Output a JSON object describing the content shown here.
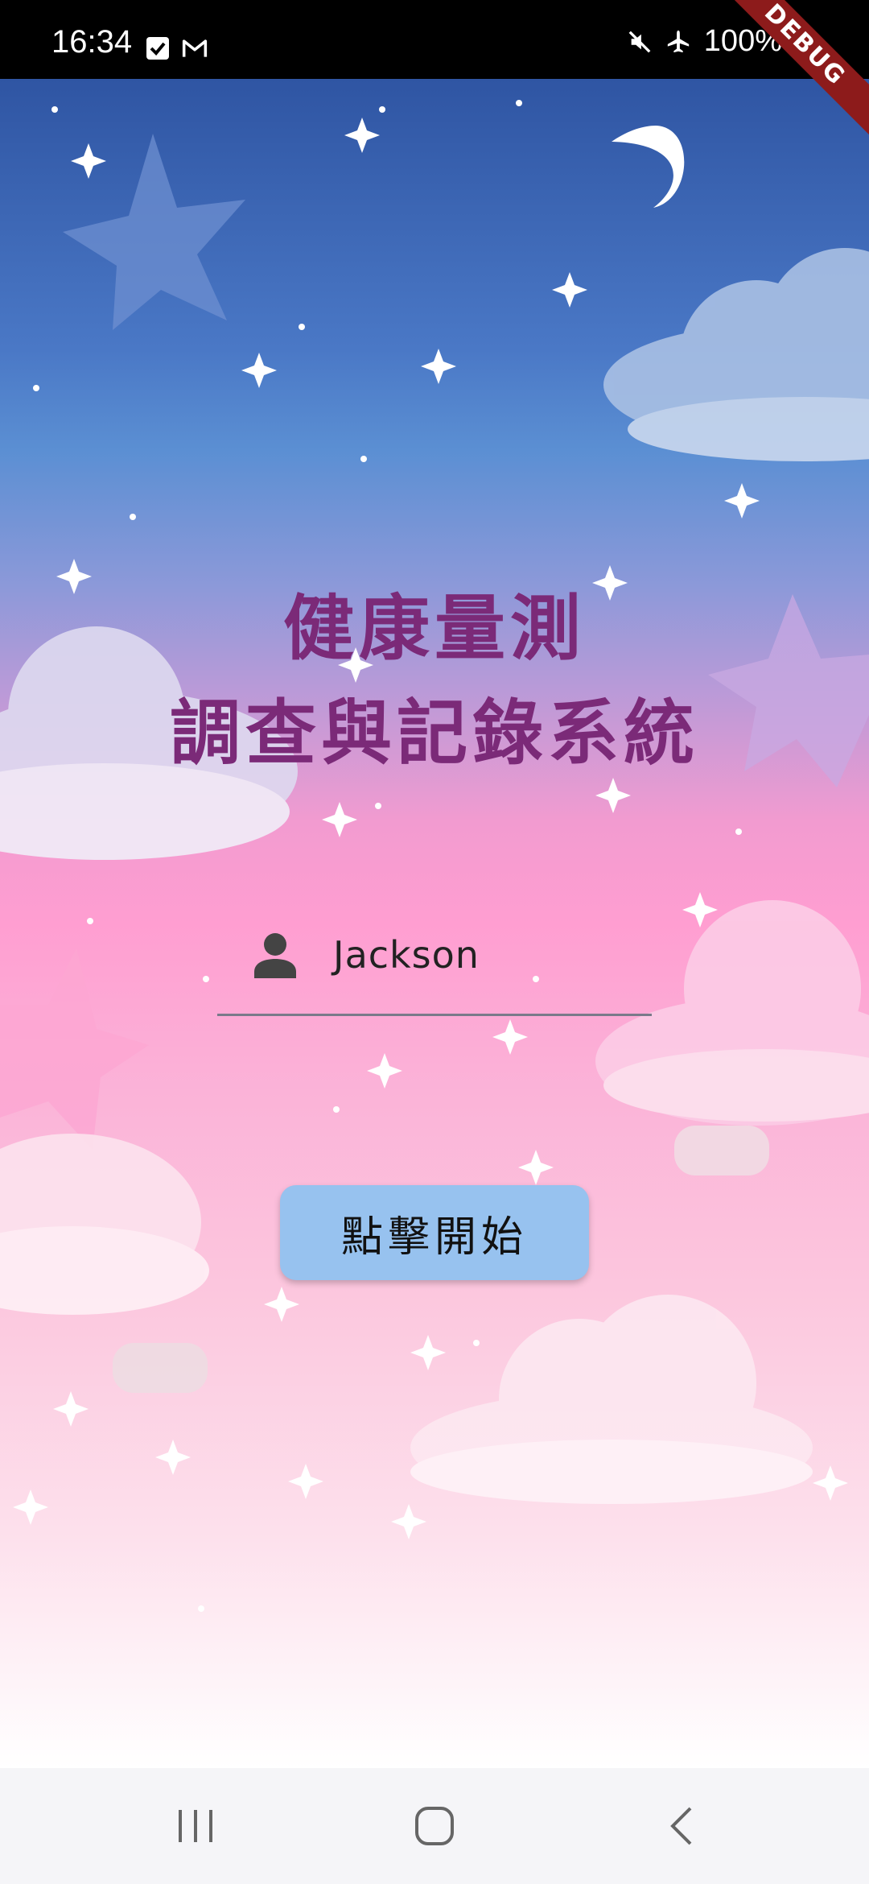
{
  "status_bar": {
    "time": "16:34",
    "left_icons": [
      "checkbox-notification-icon",
      "gmail-icon"
    ],
    "right_icons": [
      "mute-icon",
      "airplane-mode-icon",
      "battery-icon"
    ],
    "battery_text": "100%"
  },
  "debug_banner": "DEBUG",
  "app": {
    "title_line1": "健康量測",
    "title_line2": "調查與記錄系統",
    "name_field": {
      "icon": "person-icon",
      "value": "Jackson"
    },
    "start_button_label": "點擊開始"
  },
  "nav_bar": {
    "items": [
      "recent-apps-icon",
      "home-icon",
      "back-icon"
    ]
  },
  "colors": {
    "title": "#7b2a78",
    "button": "#97c2ef",
    "sky_top": "#2f55a3",
    "sky_pink": "#ff9ed1"
  }
}
